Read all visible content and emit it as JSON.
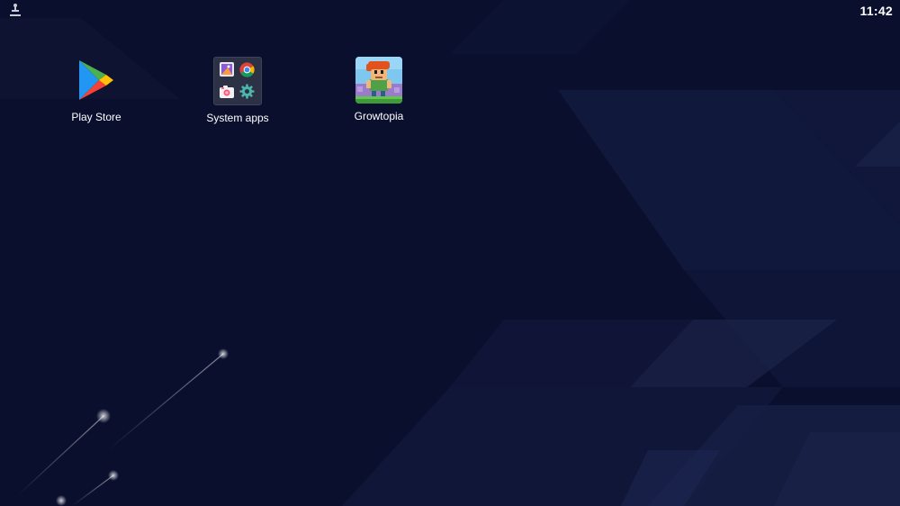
{
  "status_bar": {
    "time": "11:42",
    "left_icon": "usb-debug-icon"
  },
  "desktop": {
    "apps": [
      {
        "label": "Play Store",
        "icon": "play-store-icon"
      },
      {
        "label": "System apps",
        "icon": "folder-icon"
      },
      {
        "label": "Growtopia",
        "icon": "growtopia-icon"
      }
    ],
    "folder_contents": [
      "gallery-icon",
      "chrome-icon",
      "camera-icon",
      "settings-icon"
    ]
  },
  "colors": {
    "background": "#0a0f2e",
    "text": "#ffffff",
    "folder_bg": "#2c3146"
  }
}
